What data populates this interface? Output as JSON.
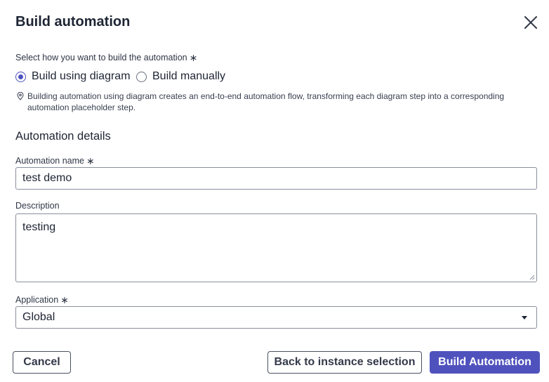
{
  "modal": {
    "title": "Build automation"
  },
  "build_method": {
    "label": "Select how you want to build the automation",
    "required_marker": "∗",
    "options": [
      {
        "label": "Build using diagram",
        "selected": true
      },
      {
        "label": "Build manually",
        "selected": false
      }
    ],
    "info_text": "Building automation using diagram creates an end-to-end automation flow, transforming each diagram step into a corresponding automation placeholder step."
  },
  "details": {
    "section_title": "Automation details",
    "name": {
      "label": "Automation name",
      "required_marker": "∗",
      "value": "test demo"
    },
    "description": {
      "label": "Description",
      "value": "testing"
    },
    "application": {
      "label": "Application",
      "required_marker": "∗",
      "value": "Global"
    }
  },
  "footer": {
    "cancel_label": "Cancel",
    "back_label": "Back to instance selection",
    "build_label": "Build Automation"
  },
  "colors": {
    "accent": "#4f52bd",
    "text": "#1d2433",
    "border": "#8a8f9c"
  },
  "icons": {
    "close": "close-icon",
    "info": "location-pin-icon",
    "dropdown": "chevron-down-icon"
  }
}
